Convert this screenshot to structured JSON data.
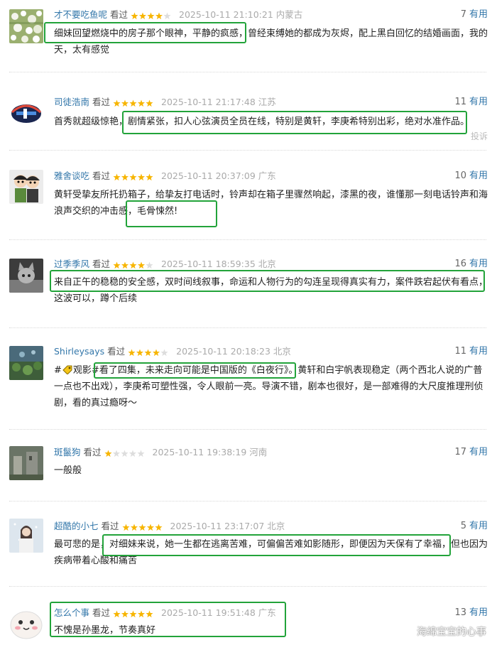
{
  "comments": [
    {
      "user": "才不要吃鱼呢",
      "status": "看过",
      "rating": 4,
      "time": "2025-10-11 21:10:21",
      "location": "内蒙古",
      "votes": "7",
      "vote_label": "有用",
      "content": "细妹回望燃烧中的房子那个眼神，平静的疯感，曾经束缚她的都成为灰烬，配上黑白回忆的结婚画面，我的天，太有感觉",
      "avatar": "white-flowers"
    },
    {
      "user": "司徒浩南",
      "status": "看过",
      "rating": 5,
      "time": "2025-10-11 21:17:48",
      "location": "江苏",
      "votes": "11",
      "vote_label": "有用",
      "content": "首秀就超级惊艳，剧情紧张，扣人心弦演员全员在线，特别是黄轩，李庚希特别出彩，绝对水准作品。",
      "report_label": "投诉",
      "avatar": "logo-emblem"
    },
    {
      "user": "雅舍谈吃",
      "status": "看过",
      "rating": 5,
      "time": "2025-10-11 20:37:09",
      "location": "广东",
      "votes": "10",
      "vote_label": "有用",
      "content": "黄轩受挚友所托扔箱子，给挚友打电话时，铃声却在箱子里骤然响起，漆黑的夜，谁懂那一刻电话铃声和海浪声交织的冲击感，毛骨悚然!",
      "avatar": "cartoon-duo"
    },
    {
      "user": "过季季风",
      "status": "看过",
      "rating": 4,
      "time": "2025-10-11 18:59:35",
      "location": "北京",
      "votes": "16",
      "vote_label": "有用",
      "content": "来自正午的稳稳的安全感，双时间线叙事，命运和人物行为的勾连呈现得真实有力，案件跌宕起伏有看点，这波可以，蹲个后续",
      "avatar": "cat-photo"
    },
    {
      "user": "Shirleysays",
      "status": "看过",
      "rating": 4,
      "time": "2025-10-11 20:18:23",
      "location": "北京",
      "votes": "11",
      "vote_label": "有用",
      "content_prefix": "#",
      "content_tag": "观影#",
      "content": "看了四集，未来走向可能是中国版的《白夜行》。黄轩和白宇帆表现稳定（两个西北人说的广普一点也不出戏），李庚希可塑性强，令人眼前一亮。导演不错，剧本也很好，是一部难得的大尺度推理刑侦剧，看的真过瘾呀～",
      "avatar": "lotus-pond"
    },
    {
      "user": "斑鬣狗",
      "status": "看过",
      "rating": 1,
      "time": "2025-10-11 19:38:19",
      "location": "河南",
      "votes": "17",
      "vote_label": "有用",
      "content": "一般般",
      "avatar": "stone-ruins"
    },
    {
      "user": "超酷的小七",
      "status": "看过",
      "rating": 5,
      "time": "2025-10-11 23:17:07",
      "location": "北京",
      "votes": "5",
      "vote_label": "有用",
      "content": "最可悲的是，对细妹来说，她一生都在逃离苦难，可偏偏苦难如影随形，即便因为天保有了幸福，但也因为疾病带着心酸和痛苦",
      "avatar": "snow-girl"
    },
    {
      "user": "怎么个事",
      "status": "看过",
      "rating": 5,
      "time": "2025-10-11 19:51:48",
      "location": "广东",
      "votes": "13",
      "vote_label": "有用",
      "content": "不愧是孙墨龙，节奏真好",
      "avatar": "cute-face"
    }
  ],
  "watermark": "海绵宝宝的心事",
  "colors": {
    "link": "#3377aa",
    "star": "#f7b500",
    "highlight": "#22a33a"
  }
}
